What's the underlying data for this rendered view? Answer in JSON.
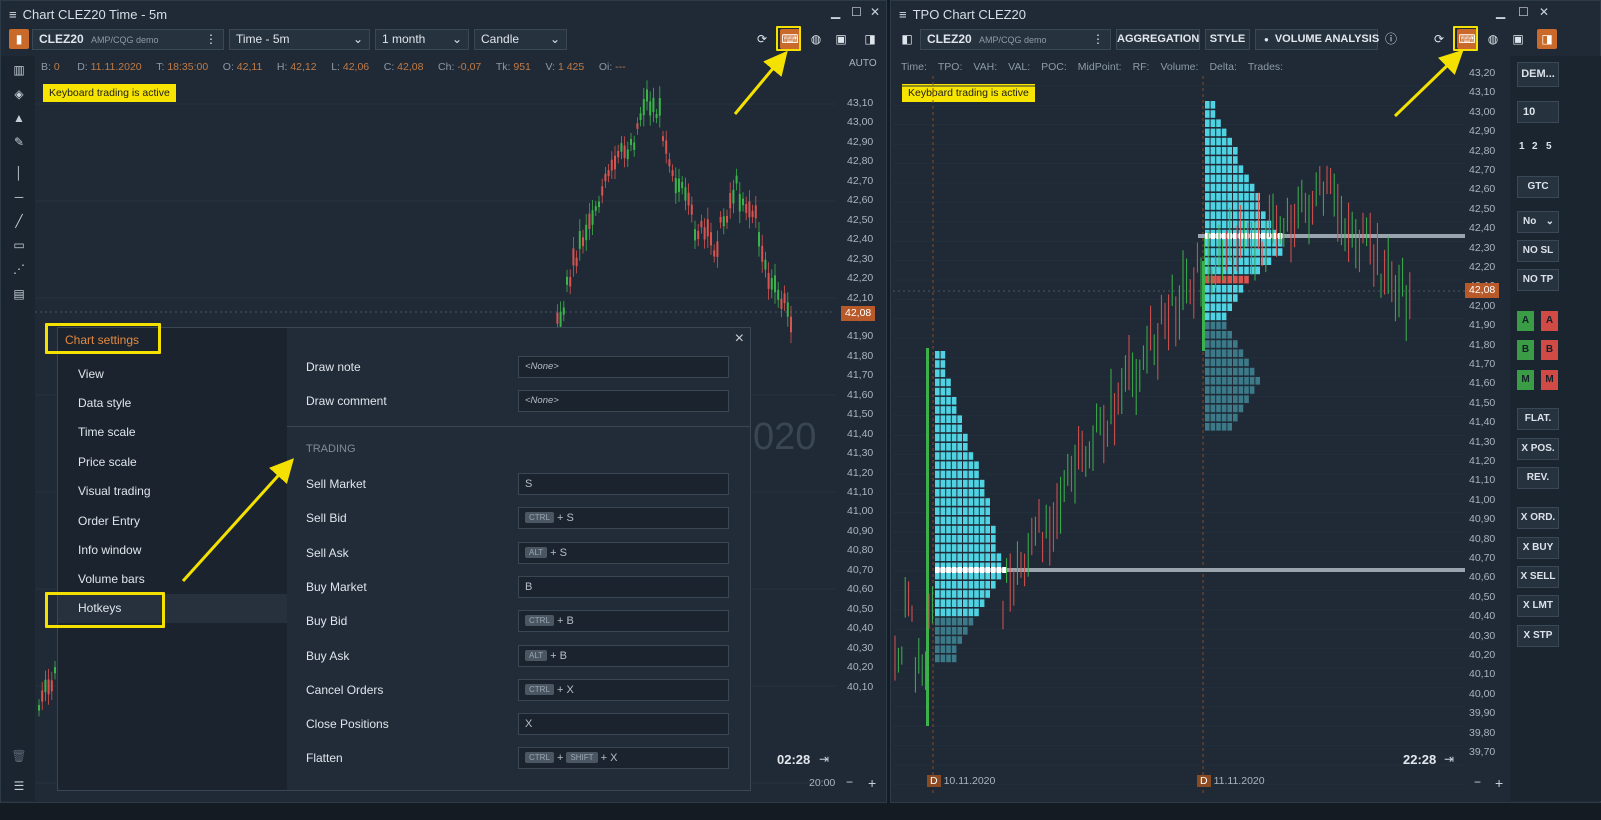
{
  "left": {
    "window_title": "Chart CLEZ20 Time - 5m",
    "symbol": "CLEZ20",
    "account": "AMP/CQG demo",
    "timeframe": "Time - 5m",
    "period": "1 month",
    "chart_type": "Candle",
    "stats": {
      "b": "B:",
      "b_v": "0",
      "d": "D:",
      "d_v": "11.11.2020",
      "t": "T:",
      "t_v": "18:35:00",
      "o": "O:",
      "o_v": "42,11",
      "h": "H:",
      "h_v": "42,12",
      "l": "L:",
      "l_v": "42,06",
      "c": "C:",
      "c_v": "42,08",
      "ch": "Ch:",
      "ch_v": "-0,07",
      "tk": "Tk:",
      "tk_v": "951",
      "v": "V:",
      "v_v": "1 425",
      "oi": "Oi:",
      "oi_v": "---"
    },
    "keyboard_badge": "Keyboard trading is active",
    "auto_label": "AUTO",
    "prices": [
      "43,10",
      "43,00",
      "42,90",
      "42,80",
      "42,70",
      "42,60",
      "42,50",
      "42,40",
      "42,30",
      "42,20",
      "42,10",
      "42,00",
      "41,90",
      "41,80",
      "41,70",
      "41,60",
      "41,50",
      "41,40",
      "41,30",
      "41,20",
      "41,10",
      "41,00",
      "40,90",
      "40,80",
      "40,70",
      "40,60",
      "40,50",
      "40,40",
      "40,30",
      "40,20",
      "40,10"
    ],
    "last_price": "42,08",
    "clock": "02:28",
    "time_label": "20:00",
    "watermark": "020",
    "minus": "−",
    "plus": "+"
  },
  "dialog": {
    "title": "Chart settings",
    "close": "×",
    "menu": [
      "View",
      "Data style",
      "Time scale",
      "Price scale",
      "Visual trading",
      "Order Entry",
      "Info window",
      "Volume bars",
      "Hotkeys"
    ],
    "draw_note": {
      "label": "Draw note",
      "value": "<None>"
    },
    "draw_comment": {
      "label": "Draw comment",
      "value": "<None>"
    },
    "section": "TRADING",
    "hotkeys": [
      {
        "label": "Sell Market",
        "mods": [],
        "key": "S"
      },
      {
        "label": "Sell Bid",
        "mods": [
          "CTRL"
        ],
        "key": "S"
      },
      {
        "label": "Sell Ask",
        "mods": [
          "ALT"
        ],
        "key": "S"
      },
      {
        "label": "Buy Market",
        "mods": [],
        "key": "B"
      },
      {
        "label": "Buy Bid",
        "mods": [
          "CTRL"
        ],
        "key": "B"
      },
      {
        "label": "Buy Ask",
        "mods": [
          "ALT"
        ],
        "key": "B"
      },
      {
        "label": "Cancel Orders",
        "mods": [
          "CTRL"
        ],
        "key": "X"
      },
      {
        "label": "Close Positions",
        "mods": [],
        "key": "X"
      },
      {
        "label": "Flatten",
        "mods": [
          "CTRL",
          "SHIFT"
        ],
        "key": "X"
      }
    ]
  },
  "right": {
    "window_title": "TPO Chart CLEZ20",
    "symbol": "CLEZ20",
    "account": "AMP/CQG demo",
    "aggregation": "AGGREGATION",
    "style": "STYLE",
    "volume_analysis": "VOLUME ANALYSIS",
    "stats": [
      "Time:",
      "TPO:",
      "VAH:",
      "VAL:",
      "POC:",
      "MidPoint:",
      "RF:",
      "Volume:",
      "Delta:",
      "Trades:"
    ],
    "keyboard_badge": "Keyboard trading is active",
    "prices": [
      "43,20",
      "43,10",
      "43,00",
      "42,90",
      "42,80",
      "42,70",
      "42,60",
      "42,50",
      "42,40",
      "42,30",
      "42,20",
      "42,10",
      "42,00",
      "41,90",
      "41,80",
      "41,70",
      "41,60",
      "41,50",
      "41,40",
      "41,30",
      "41,20",
      "41,10",
      "41,00",
      "40,90",
      "40,80",
      "40,70",
      "40,60",
      "40,50",
      "40,40",
      "40,30",
      "40,20",
      "40,10",
      "40,00",
      "39,90",
      "39,80",
      "39,70"
    ],
    "last_price": "42,08",
    "clock": "22:28",
    "date1": "10.11.2020",
    "date2": "11.11.2020",
    "d": "D",
    "minus": "−",
    "plus": "+"
  },
  "side": {
    "account_btn": "DEM...",
    "qty": "10",
    "q1": "1",
    "q2": "2",
    "q5": "5",
    "gtc": "GTC",
    "none": "No",
    "no_sl": "NO SL",
    "no_tp": "NO TP",
    "a": "A",
    "b": "B",
    "m": "M",
    "flat": "FLAT.",
    "xpos": "X POS.",
    "rev": "REV.",
    "xord": "X ORD.",
    "xbuy": "X BUY",
    "xsell": "X SELL",
    "xlmt": "X LMT",
    "xstp": "X STP"
  },
  "colors": {
    "accent": "#c96a2a",
    "badge": "#f7e500",
    "highlight": "#f4e100",
    "up": "#3bb34a",
    "down": "#d9534f",
    "profile": "#4fd3e3"
  }
}
